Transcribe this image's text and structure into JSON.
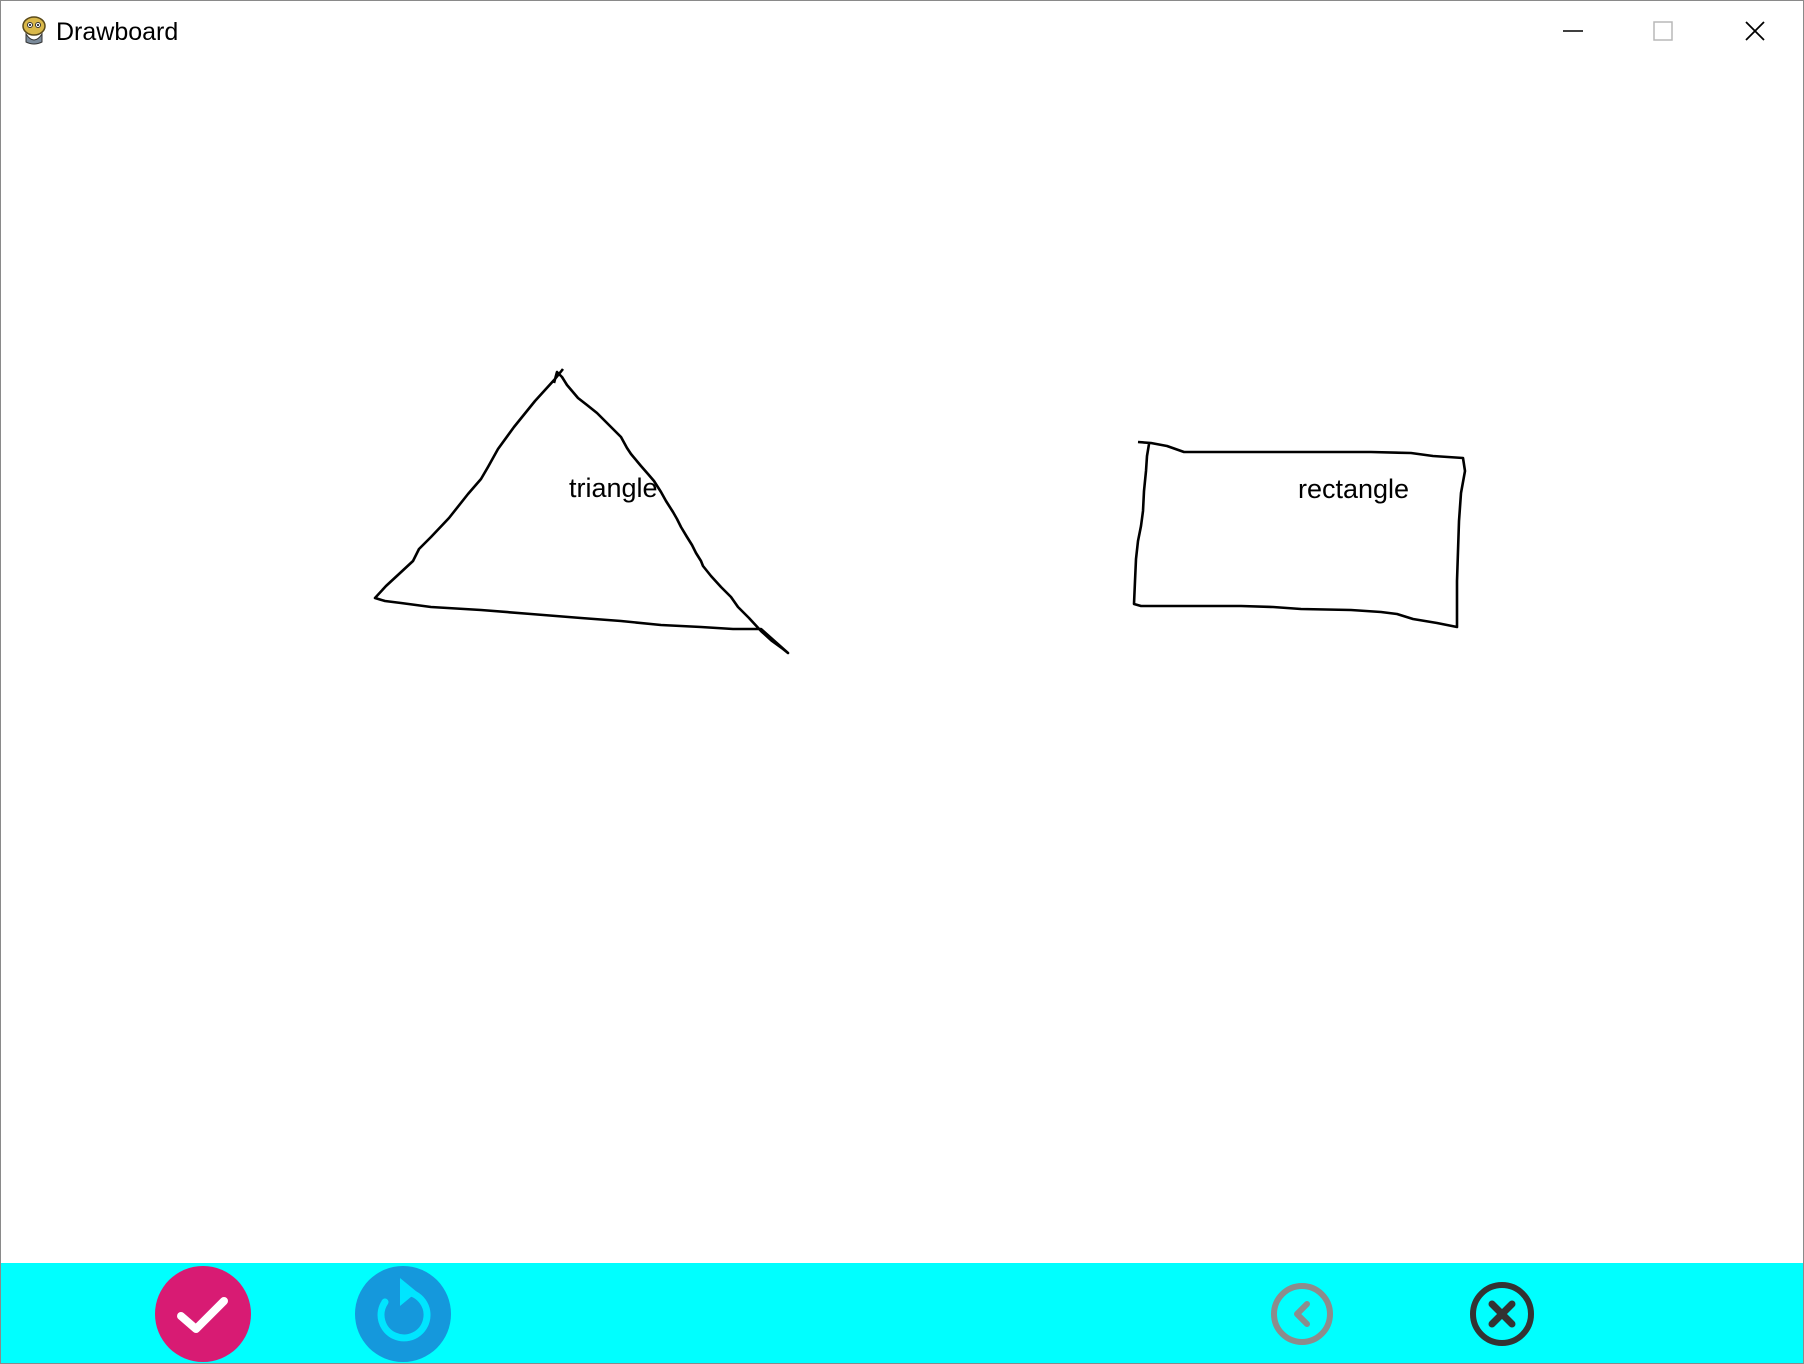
{
  "window": {
    "title": "Drawboard",
    "app_icon": "pygame-snake-icon",
    "controls": [
      "minimize-icon",
      "maximize-icon",
      "close-icon"
    ]
  },
  "canvas": {
    "background": "#ffffff",
    "stroke_color": "#000000",
    "shapes": [
      {
        "kind": "hand-drawn-triangle",
        "label": "triangle"
      },
      {
        "kind": "hand-drawn-rectangle",
        "label": "rectangle"
      }
    ]
  },
  "toolbar": {
    "background": "#00ffff",
    "buttons": [
      {
        "name": "confirm",
        "icon": "checkmark-icon",
        "color": "#d81b73"
      },
      {
        "name": "redo",
        "icon": "circular-arrow-icon",
        "color": "#1598dc"
      },
      {
        "name": "back",
        "icon": "chevron-left-circle-icon",
        "color": "#8c8c8c"
      },
      {
        "name": "cancel",
        "icon": "x-circle-icon",
        "color": "#333333"
      }
    ]
  }
}
